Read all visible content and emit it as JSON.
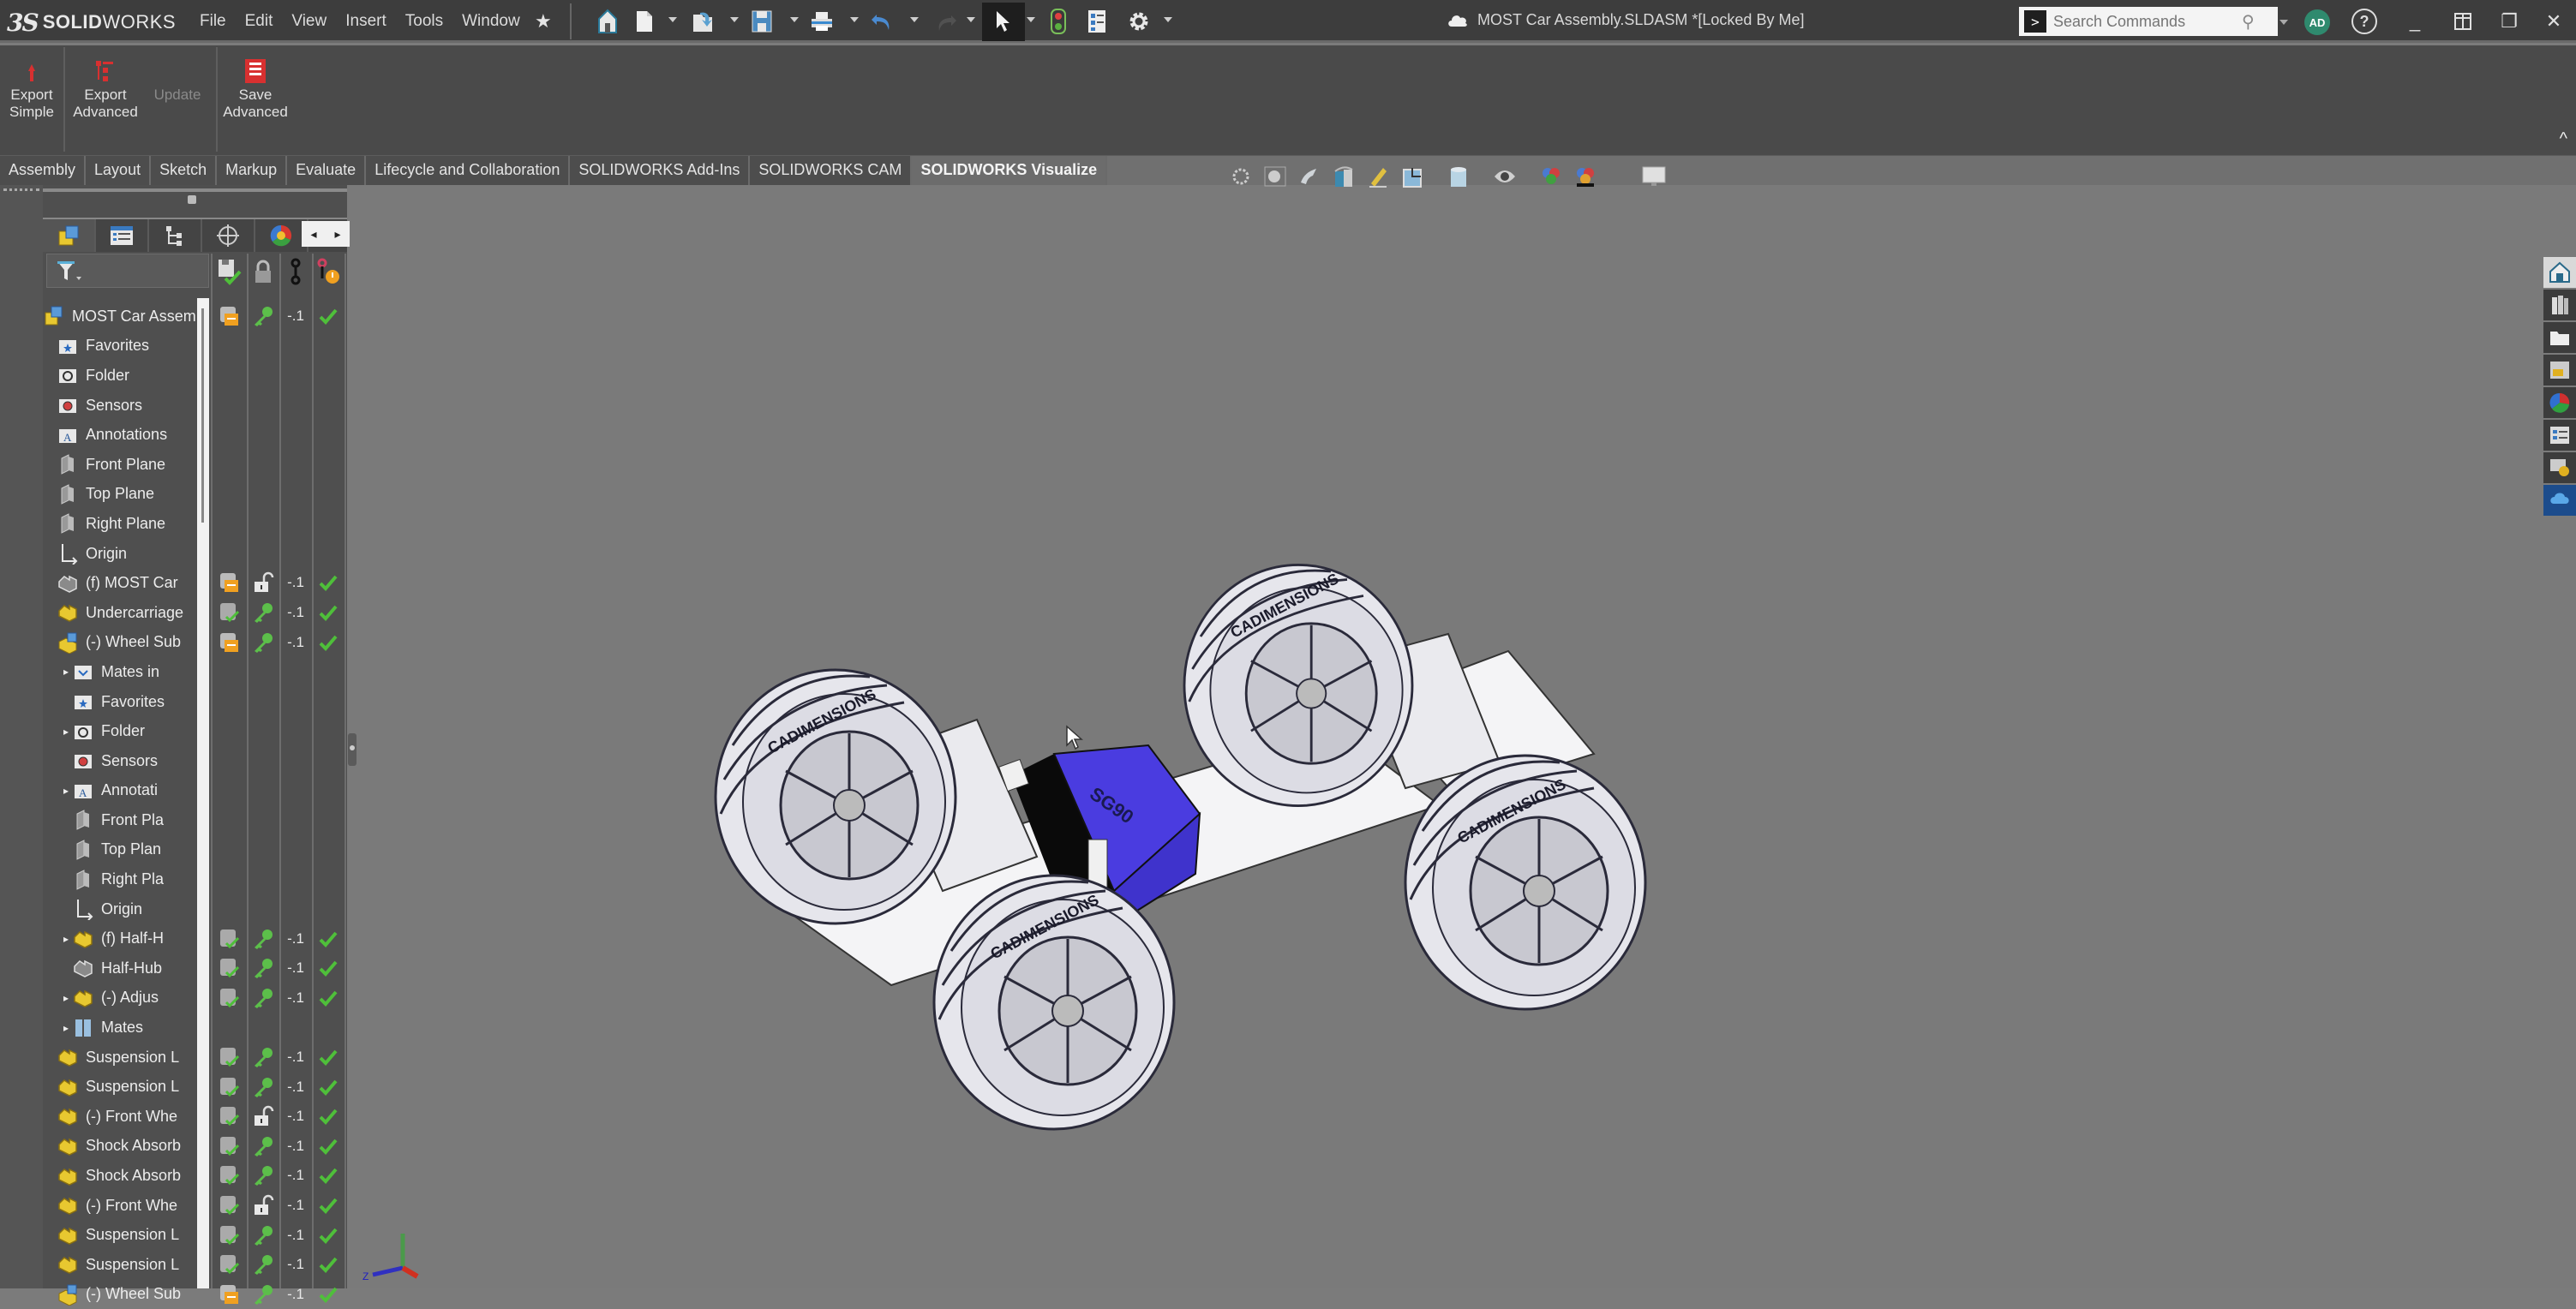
{
  "app": {
    "brand_prefix": "3S",
    "brand_bold": "SOLID",
    "brand_light": "WORKS",
    "document_title": "MOST Car Assembly.SLDASM *[Locked By Me]",
    "cloud_icon": "cloud-icon"
  },
  "menus": [
    "File",
    "Edit",
    "View",
    "Insert",
    "Tools",
    "Window"
  ],
  "quick_access": [
    {
      "name": "home",
      "icon": "home-icon"
    },
    {
      "name": "new",
      "icon": "new-document-icon"
    },
    {
      "name": "open",
      "icon": "open-icon"
    },
    {
      "name": "save",
      "icon": "save-icon"
    },
    {
      "name": "print",
      "icon": "print-icon"
    },
    {
      "name": "undo",
      "icon": "undo-icon"
    },
    {
      "name": "redo",
      "icon": "redo-icon"
    },
    {
      "name": "select",
      "icon": "select-arrow-icon"
    },
    {
      "name": "rebuild",
      "icon": "rebuild-traffic-light-icon"
    },
    {
      "name": "file-properties",
      "icon": "file-properties-icon"
    },
    {
      "name": "options",
      "icon": "gear-icon"
    }
  ],
  "search": {
    "placeholder": "Search Commands"
  },
  "user": {
    "initials": "AD"
  },
  "help_label": "?",
  "window_controls": {
    "minimize": "_",
    "tile": "▯",
    "restore": "❐",
    "close": "✕"
  },
  "ribbon": {
    "buttons": [
      {
        "label_line1": "Export",
        "label_line2": "Simple",
        "enabled": true
      },
      {
        "label_line1": "Export",
        "label_line2": "Advanced",
        "enabled": true
      },
      {
        "label_line1": "Update",
        "label_line2": "",
        "enabled": false
      },
      {
        "label_line1": "Save",
        "label_line2": "Advanced",
        "enabled": true
      }
    ],
    "collapse_icon": "^"
  },
  "tabs": [
    {
      "label": "Assembly",
      "active": false
    },
    {
      "label": "Layout",
      "active": false
    },
    {
      "label": "Sketch",
      "active": false
    },
    {
      "label": "Markup",
      "active": false
    },
    {
      "label": "Evaluate",
      "active": false
    },
    {
      "label": "Lifecycle and Collaboration",
      "active": false
    },
    {
      "label": "SOLIDWORKS Add-Ins",
      "active": false
    },
    {
      "label": "SOLIDWORKS CAM",
      "active": false
    },
    {
      "label": "SOLIDWORKS Visualize",
      "active": true
    }
  ],
  "feature_manager": {
    "panel_tabs": [
      "featuremanager-tree",
      "propertymanager",
      "configurationmanager",
      "dimxpertmanager",
      "displaymanager"
    ],
    "arrows": {
      "left": "◂",
      "right": "▸"
    },
    "columns": [
      "save-status",
      "lock",
      "revision",
      "lifecycle-state"
    ],
    "tree": [
      {
        "label": "MOST Car Assem",
        "level": 0,
        "expander": "",
        "icon": "assembly",
        "c1": "checked-out",
        "c2": "key",
        "c3": "-.1",
        "c4": "check"
      },
      {
        "label": "Favorites",
        "level": 1,
        "expander": "",
        "icon": "favorites-folder",
        "c1": "",
        "c2": "",
        "c3": "",
        "c4": ""
      },
      {
        "label": "Folder",
        "level": 1,
        "expander": "",
        "icon": "history-folder",
        "c1": "",
        "c2": "",
        "c3": "",
        "c4": ""
      },
      {
        "label": "Sensors",
        "level": 1,
        "expander": "",
        "icon": "sensors-folder",
        "c1": "",
        "c2": "",
        "c3": "",
        "c4": ""
      },
      {
        "label": "Annotations",
        "level": 1,
        "expander": "",
        "icon": "annotations-folder",
        "c1": "",
        "c2": "",
        "c3": "",
        "c4": ""
      },
      {
        "label": "Front Plane",
        "level": 1,
        "expander": "",
        "icon": "plane",
        "c1": "",
        "c2": "",
        "c3": "",
        "c4": ""
      },
      {
        "label": "Top Plane",
        "level": 1,
        "expander": "",
        "icon": "plane",
        "c1": "",
        "c2": "",
        "c3": "",
        "c4": ""
      },
      {
        "label": "Right Plane",
        "level": 1,
        "expander": "",
        "icon": "plane",
        "c1": "",
        "c2": "",
        "c3": "",
        "c4": ""
      },
      {
        "label": "Origin",
        "level": 1,
        "expander": "",
        "icon": "origin",
        "c1": "",
        "c2": "",
        "c3": "",
        "c4": ""
      },
      {
        "label": "(f) MOST Car",
        "level": 1,
        "expander": "",
        "icon": "part-gray",
        "c1": "checked-out",
        "c2": "unlocked",
        "c3": "-.1",
        "c4": "check"
      },
      {
        "label": "Undercarriage",
        "level": 1,
        "expander": "",
        "icon": "part",
        "c1": "saved",
        "c2": "key",
        "c3": "-.1",
        "c4": "check"
      },
      {
        "label": "(-) Wheel Sub",
        "level": 1,
        "expander": "",
        "icon": "subassembly",
        "c1": "checked-out",
        "c2": "key",
        "c3": "-.1",
        "c4": "check"
      },
      {
        "label": "Mates in",
        "level": 2,
        "expander": "▸",
        "icon": "mates-folder",
        "c1": "",
        "c2": "",
        "c3": "",
        "c4": ""
      },
      {
        "label": "Favorites",
        "level": 2,
        "expander": "",
        "icon": "favorites-folder",
        "c1": "",
        "c2": "",
        "c3": "",
        "c4": ""
      },
      {
        "label": "Folder",
        "level": 2,
        "expander": "▸",
        "icon": "history-folder",
        "c1": "",
        "c2": "",
        "c3": "",
        "c4": ""
      },
      {
        "label": "Sensors",
        "level": 2,
        "expander": "",
        "icon": "sensors-folder",
        "c1": "",
        "c2": "",
        "c3": "",
        "c4": ""
      },
      {
        "label": "Annotati",
        "level": 2,
        "expander": "▸",
        "icon": "annotations-folder",
        "c1": "",
        "c2": "",
        "c3": "",
        "c4": ""
      },
      {
        "label": "Front Pla",
        "level": 2,
        "expander": "",
        "icon": "plane",
        "c1": "",
        "c2": "",
        "c3": "",
        "c4": ""
      },
      {
        "label": "Top Plan",
        "level": 2,
        "expander": "",
        "icon": "plane",
        "c1": "",
        "c2": "",
        "c3": "",
        "c4": ""
      },
      {
        "label": "Right Pla",
        "level": 2,
        "expander": "",
        "icon": "plane",
        "c1": "",
        "c2": "",
        "c3": "",
        "c4": ""
      },
      {
        "label": "Origin",
        "level": 2,
        "expander": "",
        "icon": "origin",
        "c1": "",
        "c2": "",
        "c3": "",
        "c4": ""
      },
      {
        "label": "(f) Half-H",
        "level": 2,
        "expander": "▸",
        "icon": "part",
        "c1": "saved",
        "c2": "key",
        "c3": "-.1",
        "c4": "check"
      },
      {
        "label": "Half-Hub",
        "level": 2,
        "expander": "",
        "icon": "part-gray",
        "c1": "saved",
        "c2": "key",
        "c3": "-.1",
        "c4": "check"
      },
      {
        "label": "(-) Adjus",
        "level": 2,
        "expander": "▸",
        "icon": "part",
        "c1": "saved",
        "c2": "key",
        "c3": "-.1",
        "c4": "check"
      },
      {
        "label": "Mates",
        "level": 2,
        "expander": "▸",
        "icon": "mates",
        "c1": "",
        "c2": "",
        "c3": "",
        "c4": ""
      },
      {
        "label": "Suspension L",
        "level": 1,
        "expander": "",
        "icon": "part",
        "c1": "saved",
        "c2": "key",
        "c3": "-.1",
        "c4": "check"
      },
      {
        "label": "Suspension L",
        "level": 1,
        "expander": "",
        "icon": "part",
        "c1": "saved",
        "c2": "key",
        "c3": "-.1",
        "c4": "check"
      },
      {
        "label": "(-) Front Whe",
        "level": 1,
        "expander": "",
        "icon": "part",
        "c1": "saved",
        "c2": "unlocked",
        "c3": "-.1",
        "c4": "check"
      },
      {
        "label": "Shock Absorb",
        "level": 1,
        "expander": "",
        "icon": "part",
        "c1": "saved",
        "c2": "key",
        "c3": "-.1",
        "c4": "check"
      },
      {
        "label": "Shock Absorb",
        "level": 1,
        "expander": "",
        "icon": "part",
        "c1": "saved",
        "c2": "key",
        "c3": "-.1",
        "c4": "check"
      },
      {
        "label": "(-) Front Whe",
        "level": 1,
        "expander": "",
        "icon": "part",
        "c1": "saved",
        "c2": "unlocked",
        "c3": "-.1",
        "c4": "check"
      },
      {
        "label": "Suspension L",
        "level": 1,
        "expander": "",
        "icon": "part",
        "c1": "saved",
        "c2": "key",
        "c3": "-.1",
        "c4": "check"
      },
      {
        "label": "Suspension L",
        "level": 1,
        "expander": "",
        "icon": "part",
        "c1": "saved",
        "c2": "key",
        "c3": "-.1",
        "c4": "check"
      },
      {
        "label": "(-) Wheel Sub",
        "level": 1,
        "expander": "",
        "icon": "subassembly",
        "c1": "checked-out",
        "c2": "key",
        "c3": "-.1",
        "c4": "check"
      }
    ]
  },
  "heads_up_toolbar": [
    "zoom-to-fit-icon",
    "zoom-to-area-icon",
    "previous-view-icon",
    "section-view-icon",
    "dynamic-annotation-icon",
    "view-orientation-icon",
    "display-style-icon",
    "hide-show-icon",
    "edit-appearance-icon",
    "apply-scene-icon",
    "view-settings-icon"
  ],
  "task_pane": [
    "solidworks-resources-icon",
    "design-library-icon",
    "file-explorer-icon",
    "view-palette-icon",
    "appearances-icon",
    "custom-properties-icon",
    "solidworks-forum-icon",
    "pdm-icon"
  ],
  "model": {
    "tire_text": "CADIMENSIONS",
    "servo_text": "SG90",
    "servo_color": "#4a3ce0",
    "body_color": "#f2f2f4",
    "background_color": "#7a7a7a"
  },
  "triad": {
    "z_label": "Z"
  },
  "colors": {
    "titlebar": "#3d3d3d",
    "ribbon": "#4a4a4a",
    "panel": "#4f4f4f",
    "check_green": "#4fbf3a",
    "key_green": "#5cbf4a",
    "checked_out_orange": "#f0a020"
  }
}
